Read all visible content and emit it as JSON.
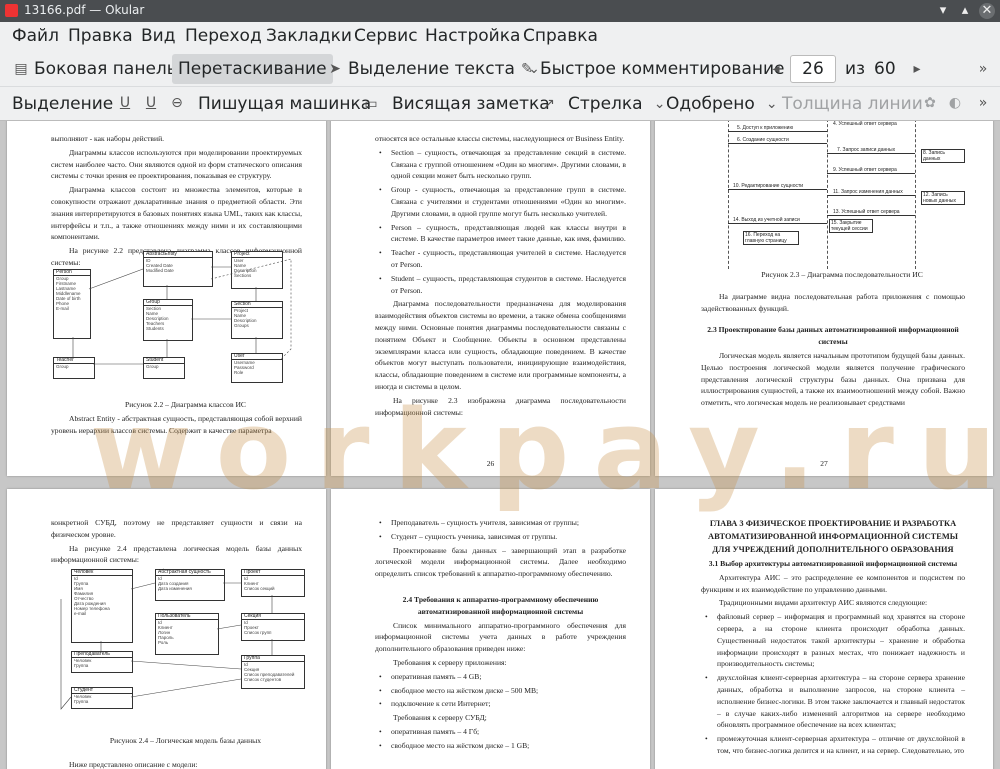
{
  "window": {
    "title": "13166.pdf — Okular"
  },
  "menu": [
    "Файл",
    "Правка",
    "Вид",
    "Переход",
    "Закладки",
    "Сервис",
    "Настройка",
    "Справка"
  ],
  "toolbar1": {
    "sidebar": "Боковая панель",
    "drag": "Перетаскивание",
    "select_text": "Выделение текста",
    "quick_comment": "Быстрое комментирование",
    "page_current": "26",
    "page_of": "из",
    "page_total": "60"
  },
  "toolbar2": {
    "highlight": "Выделение",
    "typewriter": "Пишущая машинка",
    "note": "Висящая заметка",
    "arrow": "Стрелка",
    "stamp": "Одобрено",
    "line_width": "Толщина линии"
  },
  "watermark": "workpay.ru",
  "pages": {
    "p25": {
      "lines": [
        "выполняют - как наборы действий.",
        "Диаграммы классов используются при моделировании проектируемых систем наиболее часто. Они являются одной из форм статического описания системы с точки зрения ее проектирования, показывая ее структуру.",
        "Диаграмма классов состоит из множества элементов, которые в совокупности отражают декларативные знания о предметной области. Эти знания интерпретируются в базовых понятиях языка UML, таких как классы, интерфейсы и т.п., а также отношениях между ними и их составляющими компонентами.",
        "На рисунке 2.2 представлена диаграмма классов информационной системы:"
      ],
      "caption": "Рисунок 2.2 – Диаграмма классов ИС",
      "after": "Abstract Entity - абстрактная сущность, представляющая собой верхний уровень иерархии классов системы. Содержит в качестве параметра",
      "classes": [
        {
          "name": "Person",
          "fields": [
            "Group",
            "Firstname",
            "Lastname",
            "Middlename",
            "Date of birth",
            "Phone",
            "E-mail"
          ]
        },
        {
          "name": "AbstractEntity",
          "fields": [
            "ID",
            "Created Date",
            "Modified Date"
          ]
        },
        {
          "name": "Project",
          "fields": [
            "User",
            "Name",
            "Description",
            "Sections"
          ]
        },
        {
          "name": "Group",
          "fields": [
            "Section",
            "Name",
            "Description",
            "Teachers",
            "Students"
          ]
        },
        {
          "name": "Section",
          "fields": [
            "Project",
            "Name",
            "Description",
            "Groups"
          ]
        },
        {
          "name": "Teacher",
          "fields": [
            "Group"
          ]
        },
        {
          "name": "Student",
          "fields": [
            "Group"
          ]
        },
        {
          "name": "User",
          "fields": [
            "Username",
            "Password",
            "Role"
          ]
        }
      ]
    },
    "p26": {
      "lines": [
        "относятся все остальные классы системы, наследующиеся от Business Entity.",
        "Section – сущность, отвечающая за представление секций в системе. Связана с группой отношением «Один ко многим». Другими словами, в одной секции может быть несколько групп.",
        "Group - сущность, отвечающая за представление групп в системе. Связана с учителями и студентами отношениями «Один ко многим». Другими словами, в одной группе могут быть несколько учителей.",
        "Person – сущность, представляющая людей как классы внутри в системе. В качестве параметров имеет такие данные, как имя, фамилию.",
        "Teacher - сущность, представляющая учителей в системе. Наследуется от Person.",
        "Student – сущность, представляющая студентов в системе. Наследуется от Person.",
        "Диаграмма последовательности предназначена для моделирования взаимодействия объектов системы во времени, а также обмена сообщениями между ними. Основные понятия диаграммы последовательности связаны с понятием Объект и Сообщение. Объекты в основном представлены экземплярами класса или сущность, обладающие поведением. В качестве объектов могут выступать пользователи, инициирующие взаимодействия, классы, обладающие поведением в системе или программные компоненты, а иногда и системы в целом.",
        "На рисунке 2.3 изображена диаграмма последовательности информационной системы:"
      ],
      "number": "26"
    },
    "p27": {
      "seq": [
        "5. Доступ к приложению",
        "6. Создание сущности",
        "7. Запрос записи данных",
        "8. Запись данных",
        "9. Успешный ответ сервера",
        "10. Редактирование сущности",
        "11. Запрос изменения данных",
        "12. Запись новых данных",
        "13. Успешный ответ сервера",
        "14. Выход из учетной записи",
        "15. Закрытие текущей сессии",
        "16. Переход на главную страницу",
        "4. Успешный ответ сервера"
      ],
      "caption": "Рисунок 2.3 – Диаграмма последовательности ИС",
      "p1": "На диаграмме видна последовательная работа приложения с помощью задействованных функций.",
      "heading": "2.3 Проектирование базы данных автоматизированной информационной системы",
      "p2": "Логическая модель является начальным прототипом будущей базы данных. Целью построения логической модели является получение графического представления логической структуры базы данных. Она призвана для иллюстрирования сущностей, а также их взаимоотношений между собой. Важно отметить, что логическая модель не реализовывает средствами",
      "number": "27"
    },
    "p28": {
      "lines": [
        "конкретной СУБД, поэтому не представляет сущности и связи на физическом уровне.",
        "На рисунке 2.4 представлена логическая модель базы данных информационной системы:"
      ],
      "caption": "Рисунок 2.4 – Логическая модель базы данных",
      "after": "Ниже представлено описание с модели:",
      "entities": [
        {
          "name": "Человек",
          "fields": [
            "Id",
            "Группа",
            "Имя",
            "Фамилия",
            "Отчество",
            "Дата рождения",
            "Номер телефона",
            "e-mail"
          ]
        },
        {
          "name": "Абстрактная сущность",
          "fields": [
            "Id",
            "Дата создания",
            "Дата изменения"
          ]
        },
        {
          "name": "Проект",
          "fields": [
            "Id",
            "Клиент",
            "Список секций"
          ]
        },
        {
          "name": "Преподаватель",
          "fields": [
            "Человек",
            "Группа"
          ]
        },
        {
          "name": "Пользователь",
          "fields": [
            "Id",
            "Клиент",
            "Логин",
            "Пароль",
            "Роль"
          ]
        },
        {
          "name": "Секция",
          "fields": [
            "Id",
            "Проект",
            "Список групп"
          ]
        },
        {
          "name": "Студент",
          "fields": [
            "Человек",
            "Группа"
          ]
        },
        {
          "name": "Группа",
          "fields": [
            "Id",
            "Секция",
            "Список преподавателей",
            "Список студентов"
          ]
        }
      ]
    },
    "p29": {
      "bullets1": [
        "Преподаватель – сущность учителя, зависимая от группы;",
        "Студент – сущность ученика, зависимая от группы."
      ],
      "p1": "Проектирование базы данных – завершающий этап в разработке логической модели информационной системы. Далее необходимо определить список требований к аппаратно-программному обеспечению.",
      "heading": "2.4 Требования к аппаратно-программному обеспечению автоматизированной информационной системы",
      "p2": "Список минимального аппаратно-программного обеспечения для информационной системы учета данных в работе учреждения дополнительного образования приведен ниже:",
      "server_title": "Требования к серверу приложения:",
      "server": [
        "оперативная память – 4 GB;",
        "свободное место на жёстком диске – 500 MB;",
        "подключение к сети Интернет;"
      ],
      "db_title": "Требования к серверу СУБД;",
      "db": [
        "оперативная память – 4 Гб;",
        "свободное место на жёстком диске – 1 GB;"
      ]
    },
    "p30": {
      "heading": "ГЛАВА 3 ФИЗИЧЕСКОЕ ПРОЕКТИРОВАНИЕ И РАЗРАБОТКА АВТОМАТИЗИРОВАННОЙ ИНФОРМАЦИОННОЙ СИСТЕМЫ ДЛЯ УЧРЕЖДЕНИЙ ДОПОЛНИТЕЛЬНОГО ОБРАЗОВАНИЯ",
      "sub": "3.1 Выбор архитектуры автоматизированной информационной системы",
      "p1": "Архитектура АИС – это распределение ее компонентов и подсистем по функциям и их взаимодействие по управлению данными.",
      "p2": "Традиционными видами архитектур АИС являются следующие:",
      "bullets": [
        "файловый сервер – информация и программный код хранятся на стороне сервера, а на стороне клиента происходит обработка данных. Существенный недостаток такой архитектуры – хранение и обработка информации происходят в разных местах, что понижает надежность и производительность системы;",
        "двухслойная клиент-серверная архитектура – на стороне сервера хранение данных, обработка и выполнение запросов, на стороне клиента – исполнение бизнес-логики. В этом также заключается и главный недостаток – в случае каких-либо изменений алгоритмов на сервере необходимо обновлять программное обеспечение на всех клиентах;",
        "промежуточная клиент-серверная архитектура – отличие от двухслойной в том, что бизнес-логика делится и на клиент, и на сервер. Следовательно, это"
      ]
    }
  }
}
